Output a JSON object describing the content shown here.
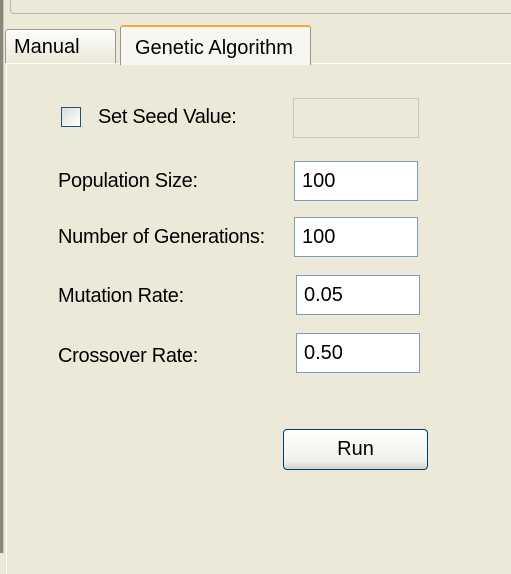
{
  "tabs": [
    {
      "label": "Manual",
      "selected": false
    },
    {
      "label": "Genetic Algorithm",
      "selected": true
    }
  ],
  "form": {
    "seed": {
      "label": "Set Seed Value:",
      "checked": false,
      "value": ""
    },
    "population": {
      "label": "Population Size:",
      "value": "100"
    },
    "generations": {
      "label": "Number of Generations:",
      "value": "100"
    },
    "mutation": {
      "label": "Mutation Rate:",
      "value": "0.05"
    },
    "crossover": {
      "label": "Crossover Rate:",
      "value": "0.50"
    }
  },
  "actions": {
    "run_label": "Run"
  },
  "colors": {
    "selected_tab_accent": "#f0a93c",
    "input_border": "#7f9db9",
    "button_border": "#003c74"
  }
}
